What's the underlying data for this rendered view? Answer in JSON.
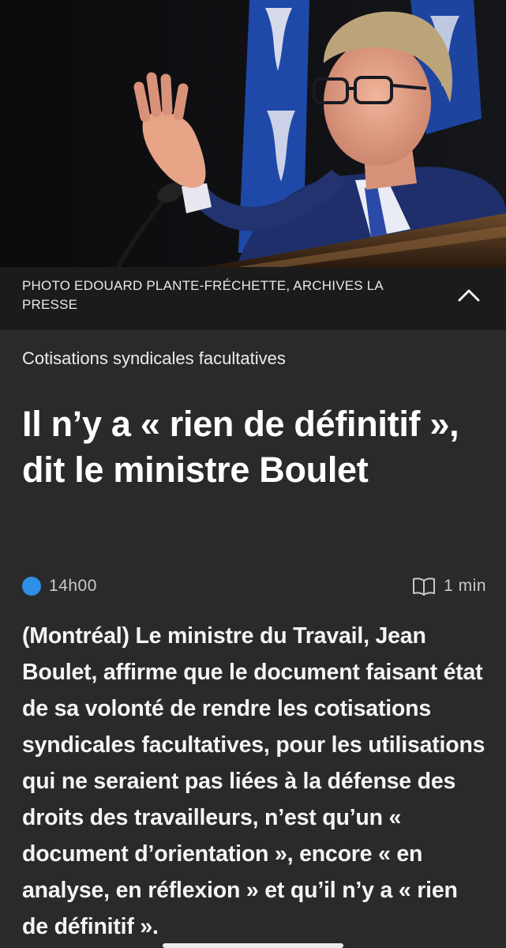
{
  "photo": {
    "credit": "PHOTO EDOUARD PLANTE-FRÉCHETTE, ARCHIVES LA PRESSE",
    "collapse_icon": "chevron-up-icon"
  },
  "article": {
    "section": "Cotisations syndicales facultatives",
    "title": "Il n’y a « rien de définitif », dit le ministre Boulet",
    "time": "14h00",
    "read_time": "1 min",
    "lead": "(Montréal) Le ministre du Travail, Jean Boulet, affirme que le document faisant état de sa volonté de rendre les cotisa­tions syndicales facultatives, pour les utilisations qui ne seraient pas liées à la défense des droits des travailleurs, n’est qu’un « document d’orientation », en­core « en analyse, en réflexion » et qu’il n’y a « rien de définitif »."
  },
  "colors": {
    "background": "#2a2a2a",
    "caption_bar": "#1b1b1b",
    "live_dot": "#2f8fe8"
  }
}
